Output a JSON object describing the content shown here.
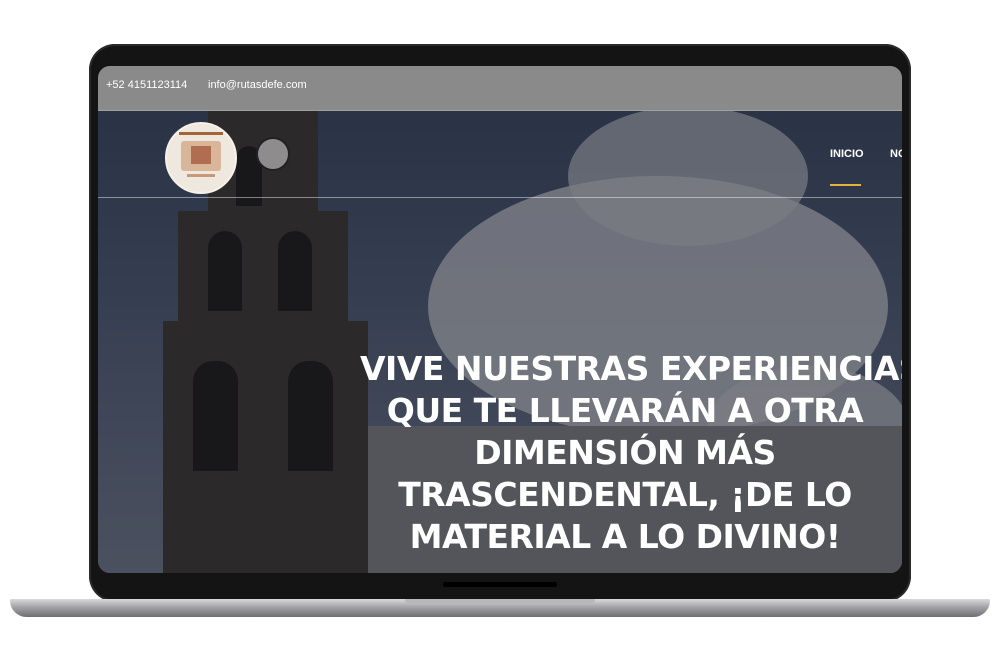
{
  "topbar": {
    "phone": "+52 4151123114",
    "email": "info@rutasdefe.com"
  },
  "logo": {
    "name": "rutas-de-fe-logo"
  },
  "nav": {
    "items": [
      {
        "label": "INICIO",
        "active": true
      },
      {
        "label": "NO",
        "active": false
      }
    ]
  },
  "hero": {
    "lines": [
      "VIVE NUESTRAS EXPERIENCIAS",
      "QUE TE LLEVARÁN A OTRA",
      "DIMENSIÓN MÁS",
      "TRASCENDENTAL, ¡DE LO",
      "MATERIAL A LO DIVINO!"
    ]
  },
  "colors": {
    "accent": "#e2b23a",
    "topbar": "#8a8a8a",
    "text": "#ffffff"
  }
}
